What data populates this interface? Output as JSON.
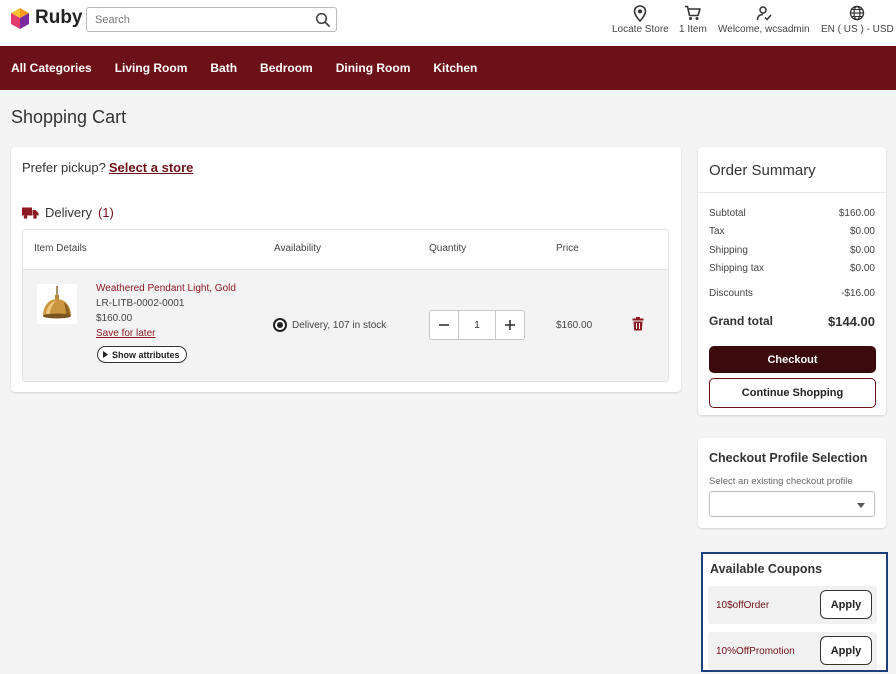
{
  "header": {
    "logo_text": "Ruby",
    "search_placeholder": "Search",
    "locate_store": "Locate Store",
    "cart_count": "1 Item",
    "welcome": "Welcome, wcsadmin",
    "locale": "EN ( US ) - USD"
  },
  "nav": {
    "items": [
      "All Categories",
      "Living Room",
      "Bath",
      "Bedroom",
      "Dining Room",
      "Kitchen"
    ]
  },
  "page": {
    "title": "Shopping Cart"
  },
  "cart": {
    "pickup_prompt": "Prefer pickup?",
    "select_store": "Select a store",
    "delivery_label": "Delivery",
    "delivery_count": "(1)",
    "columns": {
      "details": "Item Details",
      "availability": "Availability",
      "quantity": "Quantity",
      "price": "Price"
    },
    "item": {
      "name": "Weathered Pendant Light, Gold",
      "sku": "LR-LITB-0002-0001",
      "unit_price": "$160.00",
      "save_for_later": "Save for later",
      "show_attributes": "Show attributes",
      "availability": "Delivery, 107 in stock",
      "quantity": "1",
      "price": "$160.00"
    }
  },
  "summary": {
    "title": "Order Summary",
    "subtotal_label": "Subtotal",
    "subtotal": "$160.00",
    "tax_label": "Tax",
    "tax": "$0.00",
    "shipping_label": "Shipping",
    "shipping": "$0.00",
    "shipping_tax_label": "Shipping tax",
    "shipping_tax": "$0.00",
    "discounts_label": "Discounts",
    "discounts": "-$16.00",
    "grand_total_label": "Grand total",
    "grand_total": "$144.00",
    "checkout": "Checkout",
    "continue": "Continue Shopping"
  },
  "profile": {
    "title": "Checkout Profile Selection",
    "subtitle": "Select an existing checkout profile",
    "selected": ""
  },
  "coupons": {
    "title": "Available Coupons",
    "items": [
      {
        "code": "10$offOrder",
        "action": "Apply"
      },
      {
        "code": "10%OffPromotion",
        "action": "Apply"
      }
    ]
  },
  "colors": {
    "brand": "#6d1118",
    "checkout": "#3a0a0d",
    "highlight_border": "#1e3f7a"
  }
}
